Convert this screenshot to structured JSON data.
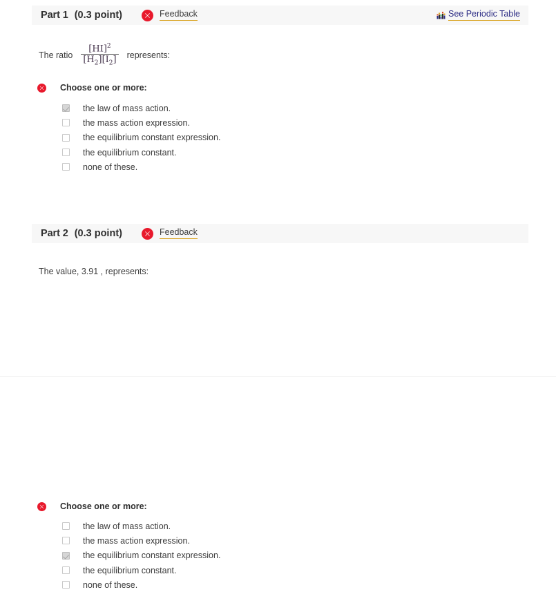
{
  "parts": [
    {
      "title": "Part 1",
      "points": "(0.3 point)",
      "status_icon": "error-circle-x-icon",
      "feedback_label": "Feedback",
      "periodic_table": {
        "label": "See Periodic Table",
        "icon": "periodic-table-icon"
      },
      "question": {
        "prefix": "The ratio",
        "suffix": "represents:",
        "formula": {
          "numerator": "[HI]",
          "numerator_exponent": "2",
          "denominator_a": "[H",
          "denominator_a_sub": "2",
          "denominator_a_close": "]",
          "denominator_b": "[I",
          "denominator_b_sub": "2",
          "denominator_b_close": "]",
          "plain": "[HI]^2 / ([H2][I2])"
        }
      },
      "choose_prompt": "Choose one or more:",
      "choose_icon": "error-circle-x-icon",
      "options": [
        {
          "label": "the law of mass action.",
          "checked": true
        },
        {
          "label": "the mass action expression.",
          "checked": false
        },
        {
          "label": "the equilibrium constant expression.",
          "checked": false
        },
        {
          "label": "the equilibrium constant.",
          "checked": false
        },
        {
          "label": "none of these.",
          "checked": false
        }
      ]
    },
    {
      "title": "Part 2",
      "points": "(0.3 point)",
      "status_icon": "error-circle-x-icon",
      "feedback_label": "Feedback",
      "question": {
        "text": "The value, 3.91 , represents:",
        "value": "3.91"
      },
      "choose_prompt": "Choose one or more:",
      "choose_icon": "error-circle-x-icon",
      "options": [
        {
          "label": "the law of mass action.",
          "checked": false
        },
        {
          "label": "the mass action expression.",
          "checked": false
        },
        {
          "label": "the equilibrium constant expression.",
          "checked": true
        },
        {
          "label": "the equilibrium constant.",
          "checked": false
        },
        {
          "label": "none of these.",
          "checked": false
        }
      ]
    }
  ],
  "colors": {
    "error_red": "#e8192c",
    "link_underline": "#d9a11a",
    "header_band": "#f7f7f7",
    "periodic_link_text": "#2e2e86",
    "body_text": "#3b3b3b"
  }
}
